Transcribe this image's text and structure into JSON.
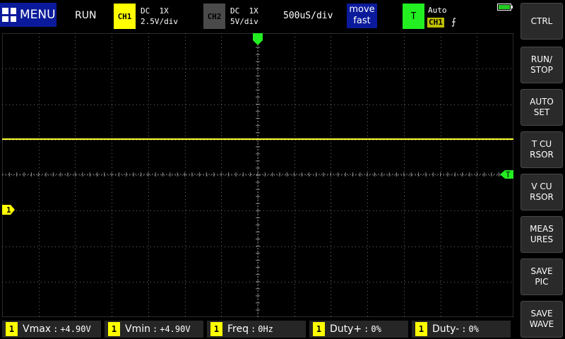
{
  "topbar": {
    "menu_label": "MENU",
    "run_state": "RUN",
    "ch1": {
      "badge": "CH1",
      "coupling": "DC  1X",
      "scale": "2.5V/div",
      "color": "#ffff00"
    },
    "ch2": {
      "badge": "CH2",
      "coupling": "DC  1X",
      "scale": "5V/div",
      "color": "#4a4a4a"
    },
    "timebase": "500uS/div",
    "move_line1": "move",
    "move_line2": "fast",
    "trigger": {
      "badge": "T",
      "mode": "Auto",
      "source": "CH1",
      "edge": "⨍",
      "color": "#22ee22"
    },
    "battery_icon": "battery-full-icon"
  },
  "screen": {
    "ch1_marker": "1",
    "trigger_level_marker": "T",
    "trace_color": "#ffff33",
    "grid": "on"
  },
  "side_buttons": [
    {
      "id": "ctrl",
      "label": "CTRL"
    },
    {
      "id": "run-stop",
      "label": "RUN/\nSTOP"
    },
    {
      "id": "autoset",
      "label": "AUTO\nSET"
    },
    {
      "id": "t-cursor",
      "label": "T CU\nRSOR"
    },
    {
      "id": "v-cursor",
      "label": "V CU\nRSOR"
    },
    {
      "id": "measures",
      "label": "MEAS\nURES"
    },
    {
      "id": "save-pic",
      "label": "SAVE\nPIC"
    },
    {
      "id": "save-wave",
      "label": "SAVE\nWAVE"
    }
  ],
  "measurements": [
    {
      "ch": "1",
      "label": "Vmax",
      "value": "+4.90V"
    },
    {
      "ch": "1",
      "label": "Vmin",
      "value": "+4.90V"
    },
    {
      "ch": "1",
      "label": "Freq",
      "value": "0Hz"
    },
    {
      "ch": "1",
      "label": "Duty+",
      "value": "0%"
    },
    {
      "ch": "1",
      "label": "Duty-",
      "value": "0%"
    }
  ]
}
